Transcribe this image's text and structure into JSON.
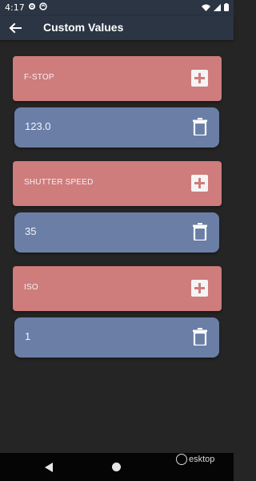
{
  "status_bar": {
    "time": "4:17"
  },
  "app_bar": {
    "title": "Custom Values"
  },
  "sections": [
    {
      "label": "F-STOP",
      "value": "123.0"
    },
    {
      "label": "SHUTTER SPEED",
      "value": "35"
    },
    {
      "label": "ISO",
      "value": "1"
    }
  ],
  "colors": {
    "header": "#ce7c7c",
    "value_card": "#6a7ea6",
    "app_bar": "#2c3544",
    "background": "#252525"
  },
  "watermark": {
    "text": "esktop"
  }
}
